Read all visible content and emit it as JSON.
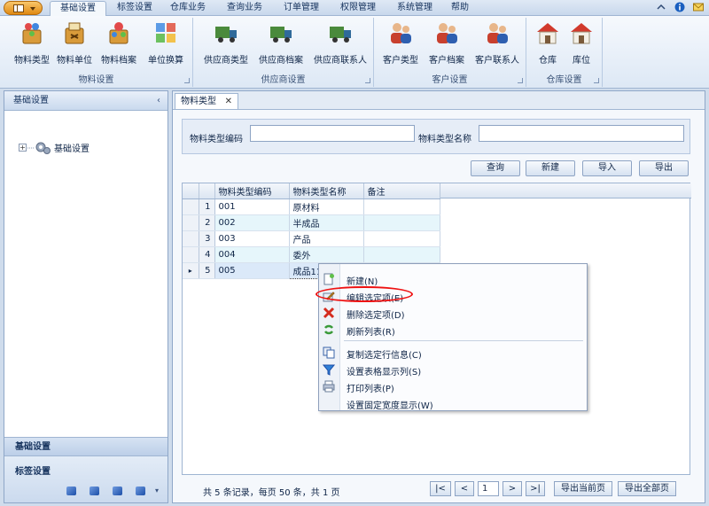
{
  "ribbon": {
    "tabs": [
      "基础设置",
      "标签设置",
      "仓库业务",
      "查询业务",
      "订单管理",
      "权限管理",
      "系统管理",
      "帮助"
    ],
    "groups": [
      {
        "title": "物料设置",
        "buttons": [
          "物料类型",
          "物料单位",
          "物料档案",
          "单位换算"
        ]
      },
      {
        "title": "供应商设置",
        "buttons": [
          "供应商类型",
          "供应商档案",
          "供应商联系人"
        ]
      },
      {
        "title": "客户设置",
        "buttons": [
          "客户类型",
          "客户档案",
          "客户联系人"
        ]
      },
      {
        "title": "仓库设置",
        "buttons": [
          "仓库",
          "库位"
        ]
      }
    ]
  },
  "sidebar": {
    "header": "基础设置",
    "tree_root": "基础设置",
    "nav_active": "基础设置",
    "nav_second": "标签设置"
  },
  "document_tab": "物料类型",
  "search": {
    "code_label": "物料类型编码",
    "name_label": "物料类型名称",
    "code_value": "",
    "name_value": ""
  },
  "actions": {
    "query": "查询",
    "new": "新建",
    "import": "导入",
    "export": "导出"
  },
  "grid": {
    "columns": [
      "物料类型编码",
      "物料类型名称",
      "备注"
    ],
    "rows": [
      {
        "no": "1",
        "code": "001",
        "name": "原材料",
        "note": ""
      },
      {
        "no": "2",
        "code": "002",
        "name": "半成品",
        "note": ""
      },
      {
        "no": "3",
        "code": "003",
        "name": "产品",
        "note": ""
      },
      {
        "no": "4",
        "code": "004",
        "name": "委外",
        "note": ""
      },
      {
        "no": "5",
        "code": "005",
        "name": "成品11",
        "note": ""
      }
    ],
    "current_row_indicator": "▸"
  },
  "context_menu": {
    "items": [
      "新建(N)",
      "编辑选定项(E)",
      "删除选定项(D)",
      "刷新列表(R)",
      "复制选定行信息(C)",
      "设置表格显示列(S)",
      "打印列表(P)",
      "设置固定宽度显示(W)"
    ]
  },
  "pager": {
    "summary": "共 5 条记录，每页 50 条，共 1 页",
    "first": "|<",
    "prev": "<",
    "page": "1",
    "next": ">",
    "last": ">|",
    "export_current": "导出当前页",
    "export_all": "导出全部页"
  },
  "colors": {
    "accent_blue": "#1d4fa8",
    "row_alt": "#e6f6fb",
    "highlight_red": "#e11"
  }
}
